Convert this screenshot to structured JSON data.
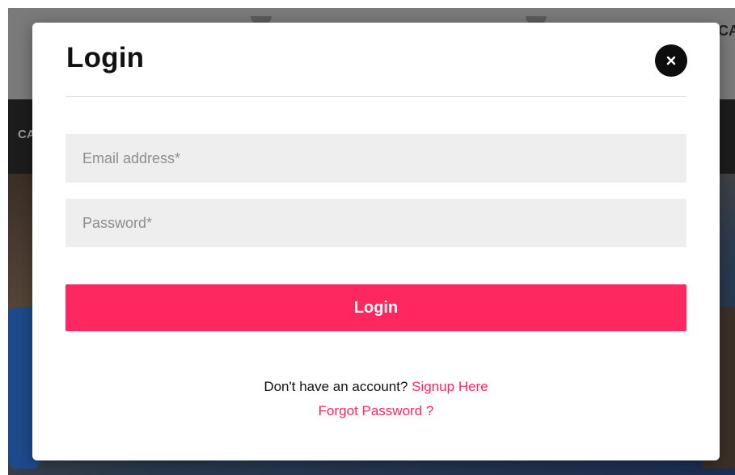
{
  "background": {
    "top_text": "CA",
    "nav_text": "CA"
  },
  "modal": {
    "title": "Login",
    "close_label": "×",
    "email_placeholder": "Email address*",
    "email_value": "",
    "password_placeholder": "Password*",
    "password_value": "",
    "login_button": "Login",
    "no_account_text": "Don't have an account?",
    "signup_link": "Signup Here",
    "forgot_link": "Forgot Password ?"
  },
  "colors": {
    "accent": "#ff2760",
    "field_bg": "#eeeeee",
    "close_bg": "#0d0d0d"
  },
  "icons": {
    "close": "close-icon"
  }
}
